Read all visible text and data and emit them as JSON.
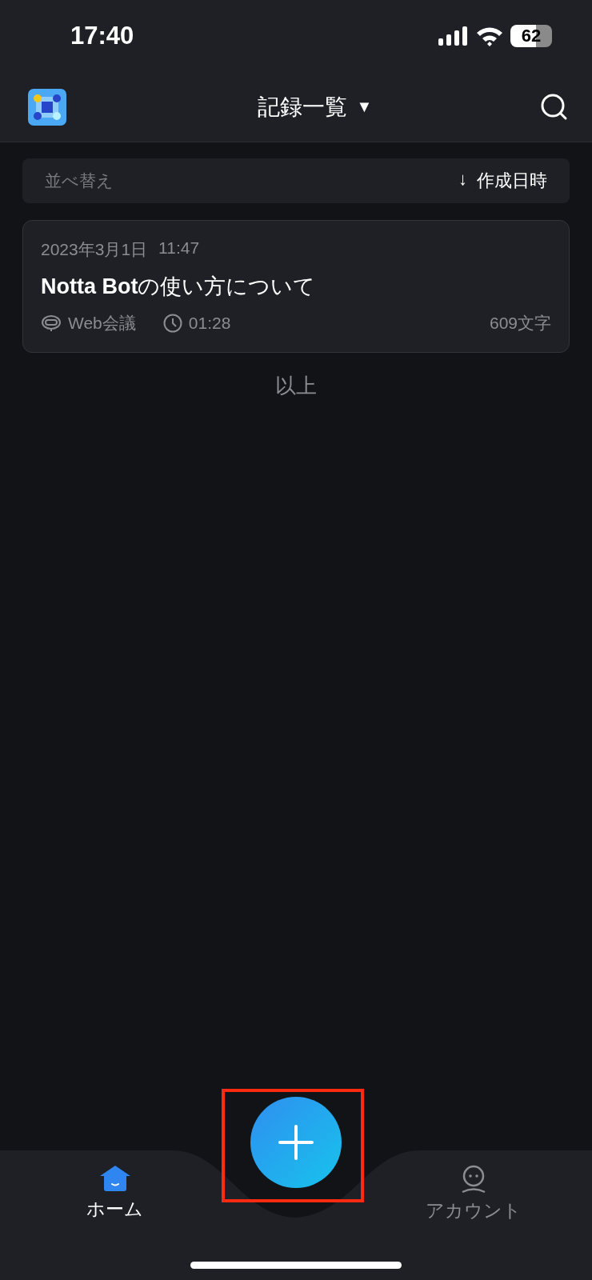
{
  "status_bar": {
    "time": "17:40",
    "battery": "62"
  },
  "header": {
    "title": "記録一覧",
    "dropdown": "▼"
  },
  "sort_bar": {
    "label": "並べ替え",
    "arrow": "↓",
    "value": "作成日時"
  },
  "records": [
    {
      "date": "2023年3月1日",
      "time": "11:47",
      "title": "**Notta Bot**の使い方について",
      "source": "Web会議",
      "duration": "01:28",
      "chars": "609文字"
    }
  ],
  "end_label": "以上",
  "tabs": [
    {
      "kind": "home",
      "label": "ホーム",
      "selected": true
    },
    {
      "kind": "account",
      "label": "アカウント",
      "selected": false
    }
  ]
}
